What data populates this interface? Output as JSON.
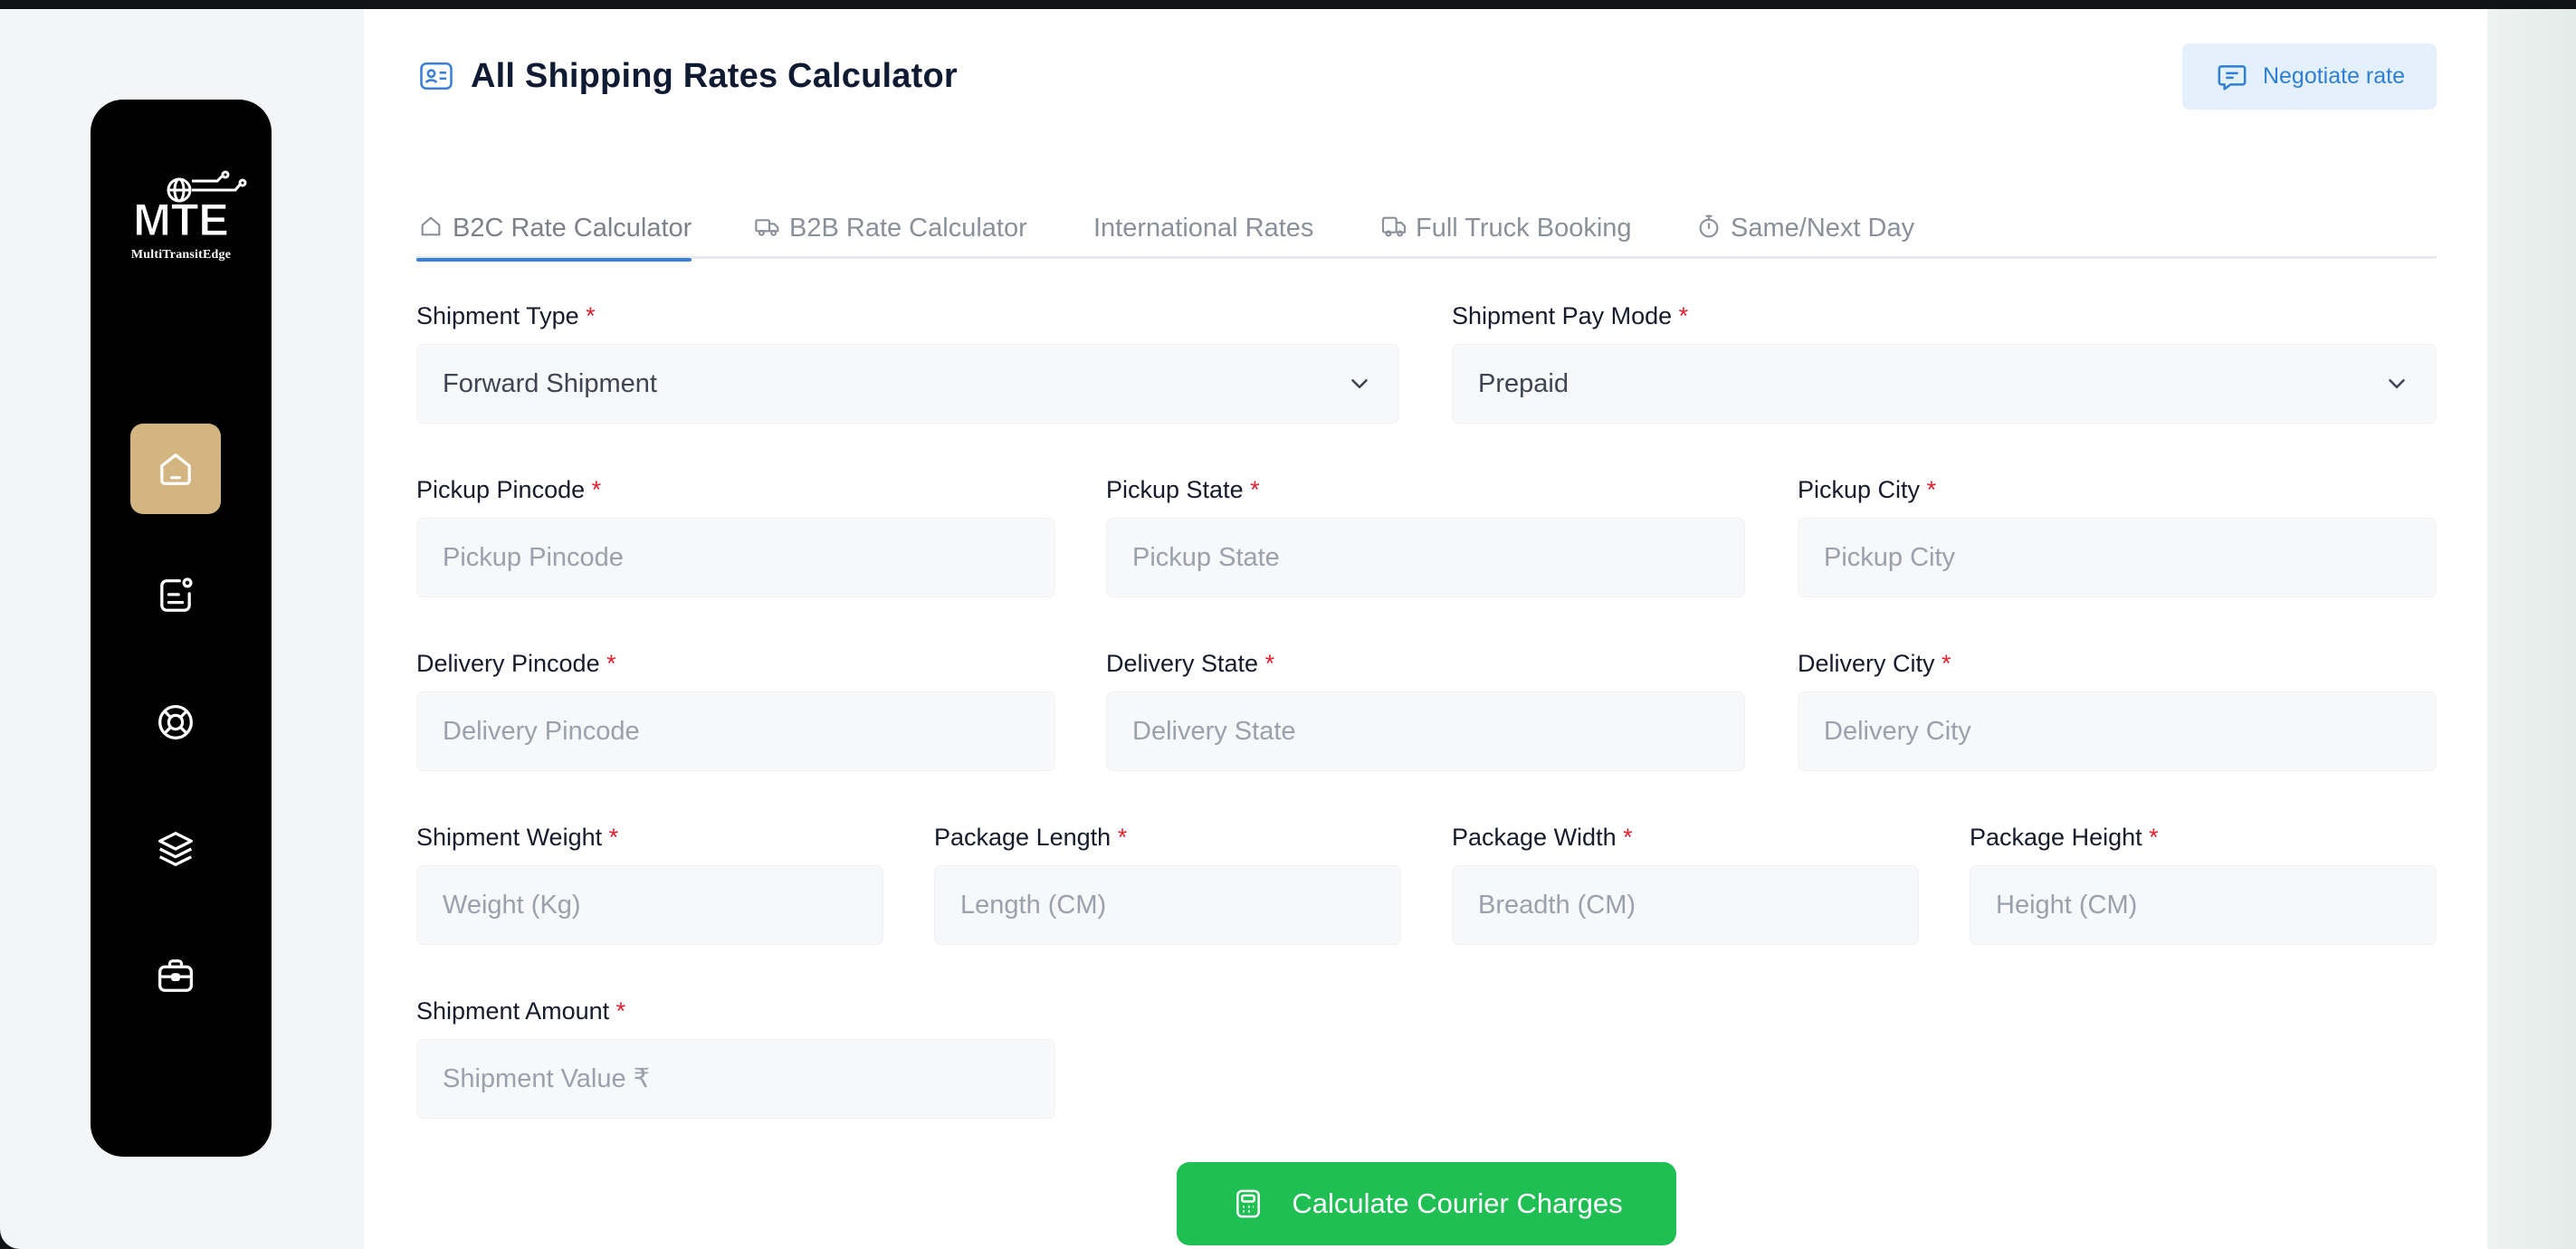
{
  "brand": {
    "logo_text": "MTE",
    "logo_subtitle": "MultiTransitEdge",
    "active_color": "#d3b582"
  },
  "sidebar": {
    "items": [
      {
        "icon": "home-icon",
        "active": true
      },
      {
        "icon": "orders-icon",
        "active": false
      },
      {
        "icon": "support-icon",
        "active": false
      },
      {
        "icon": "layers-icon",
        "active": false
      },
      {
        "icon": "briefcase-icon",
        "active": false
      }
    ]
  },
  "header": {
    "title": "All Shipping Rates Calculator",
    "negotiate_label": "Negotiate rate"
  },
  "tabs": [
    {
      "label": "B2C Rate Calculator",
      "icon": "home-icon",
      "active": true
    },
    {
      "label": "B2B Rate Calculator",
      "icon": "truck-icon",
      "active": false
    },
    {
      "label": "International Rates",
      "icon": "",
      "active": false
    },
    {
      "label": "Full Truck Booking",
      "icon": "truck-icon",
      "active": false
    },
    {
      "label": "Same/Next Day",
      "icon": "stopwatch-icon",
      "active": false
    }
  ],
  "form": {
    "required_mark": "*",
    "shipment_type": {
      "label": "Shipment Type",
      "value": "Forward Shipment"
    },
    "pay_mode": {
      "label": "Shipment Pay Mode",
      "value": "Prepaid"
    },
    "pickup_pincode": {
      "label": "Pickup Pincode",
      "placeholder": "Pickup Pincode"
    },
    "pickup_state": {
      "label": "Pickup State",
      "placeholder": "Pickup State"
    },
    "pickup_city": {
      "label": "Pickup City",
      "placeholder": "Pickup City"
    },
    "delivery_pincode": {
      "label": "Delivery Pincode",
      "placeholder": "Delivery Pincode"
    },
    "delivery_state": {
      "label": "Delivery State",
      "placeholder": "Delivery State"
    },
    "delivery_city": {
      "label": "Delivery City",
      "placeholder": "Delivery City"
    },
    "weight": {
      "label": "Shipment Weight",
      "placeholder": "Weight (Kg)"
    },
    "length": {
      "label": "Package Length",
      "placeholder": "Length (CM)"
    },
    "width": {
      "label": "Package Width",
      "placeholder": "Breadth (CM)"
    },
    "height": {
      "label": "Package Height",
      "placeholder": "Height (CM)"
    },
    "amount": {
      "label": "Shipment Amount",
      "placeholder": "Shipment Value ₹"
    }
  },
  "actions": {
    "calculate_label": "Calculate Courier Charges",
    "calculate_color": "#1fbf54"
  },
  "colors": {
    "accent": "#3a80d6",
    "required": "#e5202f"
  }
}
